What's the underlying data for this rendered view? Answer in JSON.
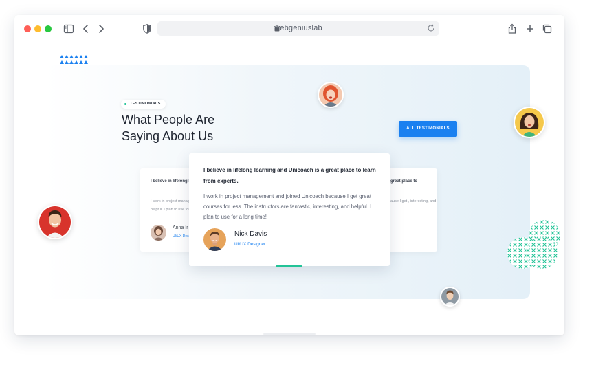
{
  "browser": {
    "url": "webgeniuslab"
  },
  "section": {
    "badge": "TESTIMONIALS",
    "title_line1": "What People Are",
    "title_line2": "Saying About Us",
    "cta_label": "ALL TESTIMONIALS"
  },
  "featured": {
    "quote": "I believe in lifelong learning and Unicoach is a great place to learn from experts.",
    "body": "I work in project management and joined Unicoach because I get great courses for less. The instructors are fantastic, interesting, and helpful. I plan to use for a long time!",
    "name": "Nick Davis",
    "role": "UI/UX Designer"
  },
  "left_card": {
    "quote": "I believe in lifelong l learn from experts.",
    "body": "I work in project manag great courses for less helpful. I plan to use for",
    "name": "Anna Ir",
    "role": "UI/UX Desi"
  },
  "right_card": {
    "quote": "great place to",
    "body": "ause I get , interesting, and",
    "name": "",
    "role": ""
  },
  "colors": {
    "accent": "#1a80f0",
    "teal": "#23c397",
    "title": "#1e2430"
  }
}
